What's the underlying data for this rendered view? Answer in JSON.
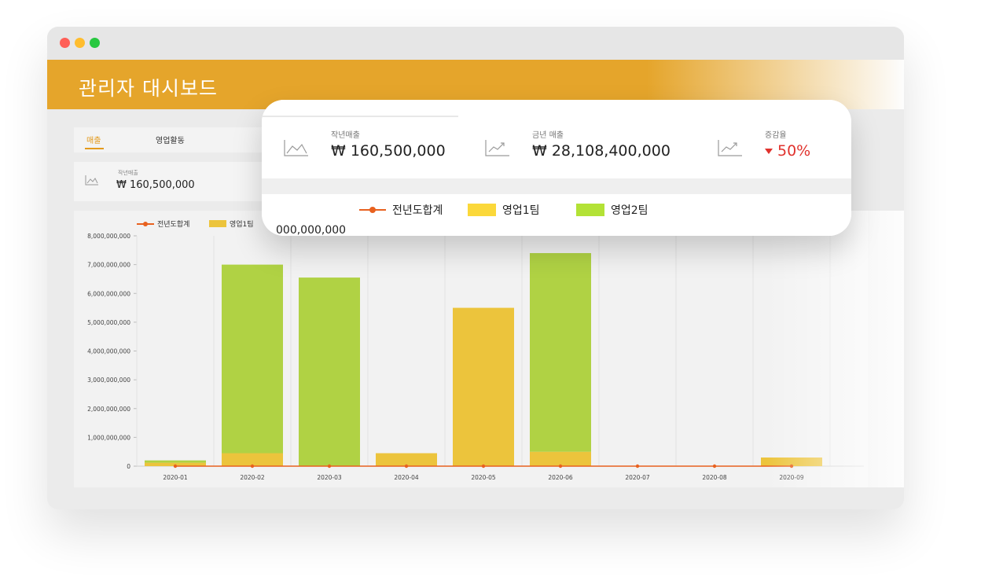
{
  "window": {
    "traffic_lights": [
      "close",
      "minimize",
      "maximize"
    ]
  },
  "header": {
    "title": "관리자 대시보드"
  },
  "tabs": [
    {
      "label": "매출",
      "active": true
    },
    {
      "label": "영업활동",
      "active": false
    }
  ],
  "summary": {
    "last_year_label": "작년매출",
    "last_year_value": "₩ 160,500,000"
  },
  "zoom": {
    "stats": [
      {
        "label": "작년매출",
        "value": "₩ 160,500,000",
        "icon": "area-chart-icon"
      },
      {
        "label": "금년 매출",
        "value": "₩ 28,108,400,000",
        "icon": "trend-chart-icon"
      },
      {
        "label": "증감율",
        "value": "50%",
        "icon": "trend-chart-icon",
        "trend": "down"
      }
    ],
    "axis_partial": "000,000,000"
  },
  "chart_data": {
    "type": "bar",
    "stacked": true,
    "categories": [
      "2020-01",
      "2020-02",
      "2020-03",
      "2020-04",
      "2020-05",
      "2020-06",
      "2020-07",
      "2020-08",
      "2020-09"
    ],
    "series": [
      {
        "name": "전년도합계",
        "type": "line",
        "color": "#e8611f",
        "values": [
          0,
          0,
          0,
          0,
          0,
          0,
          0,
          0,
          0
        ]
      },
      {
        "name": "영업1팀",
        "type": "bar",
        "color": "#ecc43c",
        "values": [
          120000000,
          450000000,
          0,
          450000000,
          5500000000,
          500000000,
          0,
          0,
          300000000
        ]
      },
      {
        "name": "영업2팀",
        "type": "bar",
        "color": "#b0d244",
        "values": [
          80000000,
          6550000000,
          6550000000,
          0,
          0,
          6900000000,
          0,
          0,
          0
        ]
      }
    ],
    "yticks": [
      "0",
      "1,000,000,000",
      "2,000,000,000",
      "3,000,000,000",
      "4,000,000,000",
      "5,000,000,000",
      "6,000,000,000",
      "7,000,000,000",
      "8,000,000,000"
    ],
    "ylim": [
      0,
      8000000000
    ],
    "grid": true,
    "legend_position": "top-left"
  },
  "legend_colors": {
    "line": "#e8611f",
    "team1": "#ecc43c",
    "team2": "#b0d244",
    "team1_bright": "#fbd83a",
    "team2_bright": "#b3e236"
  }
}
